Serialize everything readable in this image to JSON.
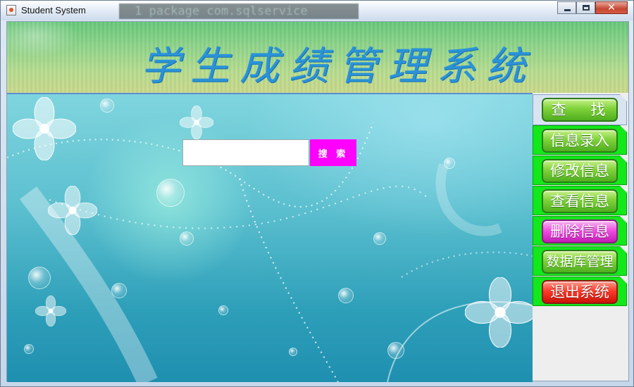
{
  "window": {
    "title": "Student System",
    "background_code_text": "1 package com.sqlservice"
  },
  "banner": {
    "title": "学生成绩管理系统"
  },
  "search": {
    "input_value": "",
    "button_label": "搜 索"
  },
  "sidebar": {
    "tabs": [
      {
        "label": "查 找",
        "style": "green",
        "selected": true
      },
      {
        "label": "信息录入",
        "style": "green",
        "selected": false
      },
      {
        "label": "修改信息",
        "style": "green",
        "selected": false
      },
      {
        "label": "查看信息",
        "style": "green",
        "selected": false
      },
      {
        "label": "删除信息",
        "style": "pink",
        "selected": false
      },
      {
        "label": "数据库管理",
        "style": "green",
        "selected": false
      },
      {
        "label": "退出系统",
        "style": "red",
        "selected": false
      }
    ]
  },
  "colors": {
    "tab_bg": "#12e81a",
    "search_button": "#ff00ff",
    "banner_text": "#2a93d8"
  }
}
